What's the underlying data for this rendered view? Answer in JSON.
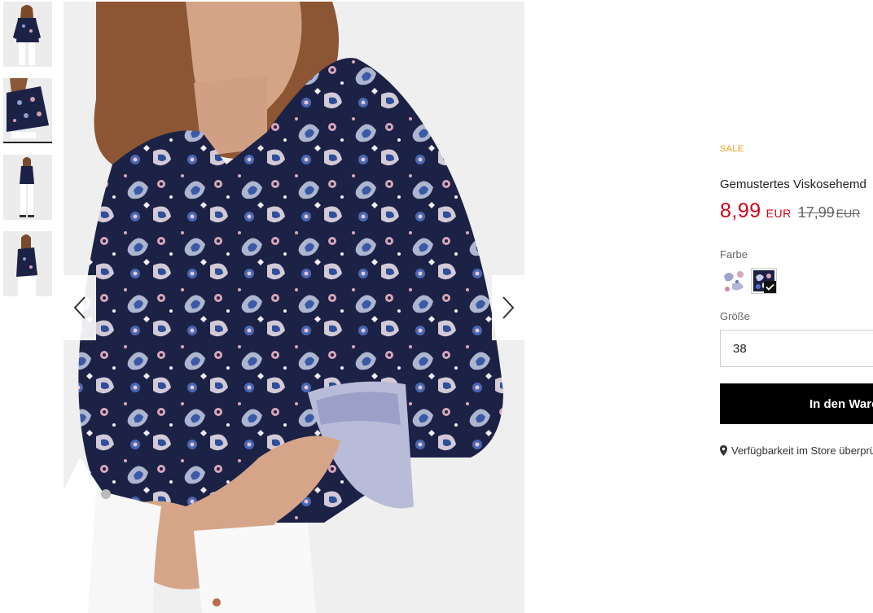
{
  "gallery": {
    "thumbnails": [
      {
        "label": "thumbnail-1",
        "active": false
      },
      {
        "label": "thumbnail-2",
        "active": true
      },
      {
        "label": "thumbnail-3",
        "active": false
      },
      {
        "label": "thumbnail-4",
        "active": false
      }
    ],
    "prev_icon": "chevron-left-icon",
    "next_icon": "chevron-right-icon"
  },
  "product": {
    "badge": "SALE",
    "title": "Gemustertes Viskosehemd",
    "price": "8,99",
    "currency": "EUR",
    "old_price": "17,99",
    "old_currency": "EUR",
    "color_label": "Farbe",
    "size_label": "Größe",
    "size_value": "38",
    "cart_label": "In den Warenkorb",
    "store_label": "Verfügbarkeit im Store überprüfen"
  },
  "colors": {
    "sale": "#f0a020",
    "price": "#d0021b",
    "navy": "#1c2246",
    "button": "#000000"
  }
}
